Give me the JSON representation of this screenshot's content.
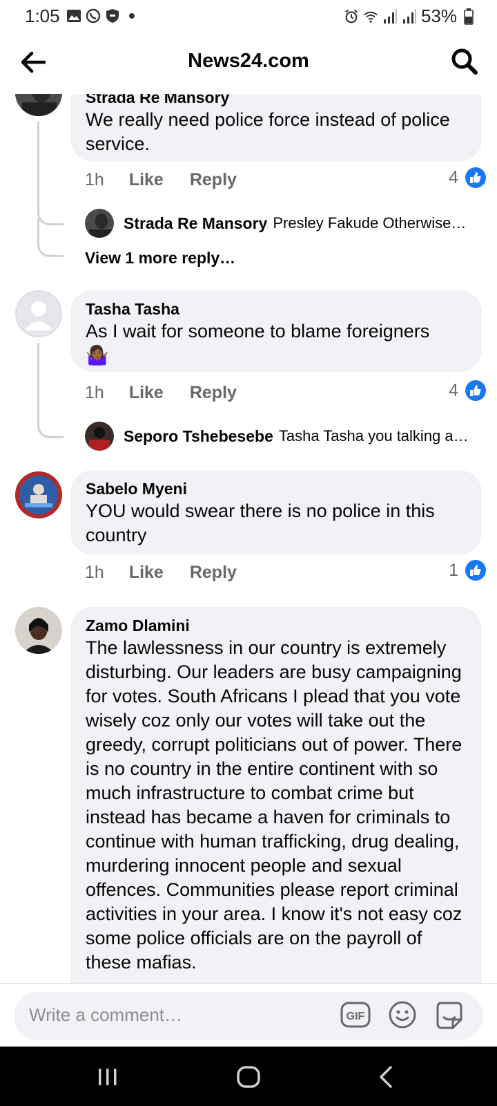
{
  "status_bar": {
    "time": "1:05",
    "battery": "53%",
    "left_icons": [
      "gallery-icon",
      "whatsapp-icon",
      "shield-icon",
      "dot-icon"
    ],
    "right_icons": [
      "alarm-icon",
      "wifi-icon",
      "signal-icon",
      "signal-icon",
      "battery-icon"
    ]
  },
  "header": {
    "title": "News24.com"
  },
  "comments": [
    {
      "author": "Strada Re Mansory",
      "text": "We really need police force instead of police service.",
      "time": "1h",
      "like_label": "Like",
      "reply_label": "Reply",
      "reactions": "4",
      "replies": [
        {
          "author": "Strada Re Mansory",
          "text": "Presley Fakude Otherwise…"
        }
      ],
      "view_more": "View 1 more reply…"
    },
    {
      "author": "Tasha Tasha",
      "text": "As I wait for someone to blame foreigners",
      "emoji": "🤷🏾‍♀️",
      "time": "1h",
      "like_label": "Like",
      "reply_label": "Reply",
      "reactions": "4",
      "replies": [
        {
          "author": "Seporo Tshebesebe",
          "text": "Tasha Tasha you talking a…"
        }
      ]
    },
    {
      "author": "Sabelo Myeni",
      "text": "YOU would swear there is no police in this country",
      "time": "1h",
      "like_label": "Like",
      "reply_label": "Reply",
      "reactions": "1"
    },
    {
      "author": "Zamo Dlamini",
      "text": "The lawlessness in our country is extremely disturbing. Our leaders are busy campaigning for votes. South Africans I plead that you vote wisely coz only our votes will take out the greedy, corrupt politicians out of power. There is no country in the entire continent with so much infrastructure to combat crime but instead has became a haven for criminals to continue with human trafficking, drug dealing, murdering innocent people and sexual offences.  Communities please report criminal activities in your area. I know it's not easy coz some police officials are on the payroll of these mafias."
    }
  ],
  "composer": {
    "placeholder": "Write a comment…",
    "gif_label": "GIF"
  },
  "colors": {
    "accent": "#1877f2",
    "bubble": "#f0f2f5",
    "muted_text": "#65676b"
  }
}
